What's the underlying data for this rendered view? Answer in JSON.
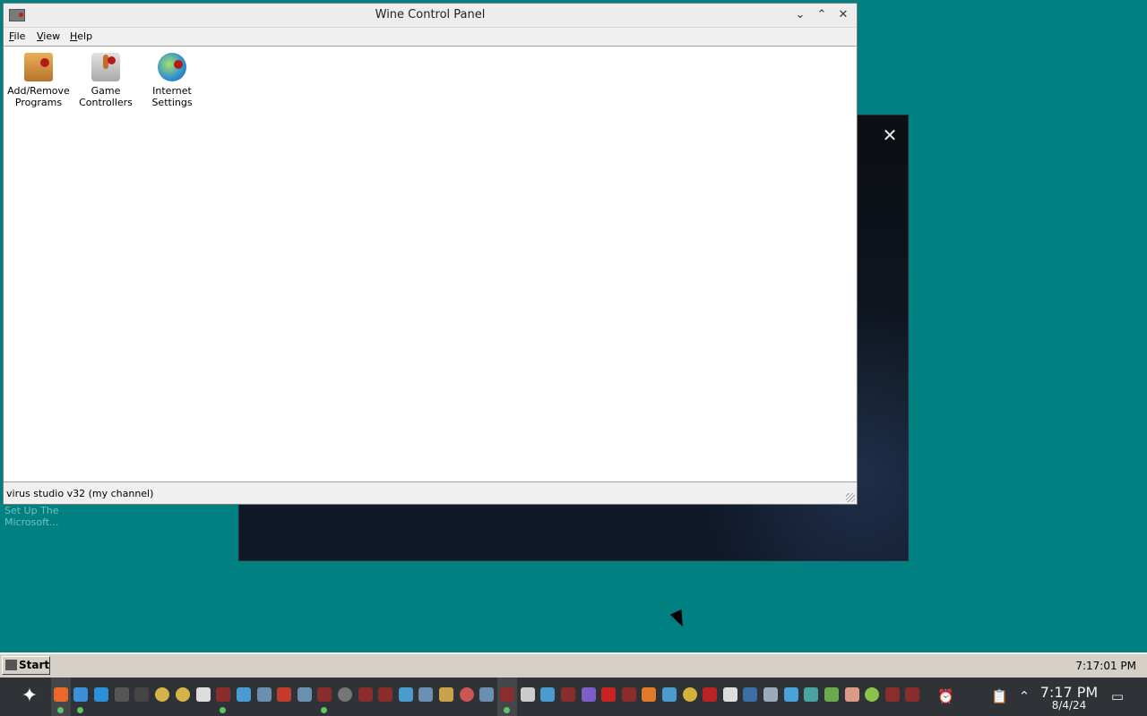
{
  "background_window": {
    "close_label": "✕"
  },
  "desktop": {
    "icon_text_line1": "Set Up The",
    "icon_text_line2": "Microsoft..."
  },
  "wine_window": {
    "title": "Wine Control Panel",
    "buttons": {
      "minimize": "⌄",
      "maximize": "⌃",
      "close": "✕"
    },
    "menu": [
      {
        "accel": "F",
        "rest": "ile"
      },
      {
        "accel": "V",
        "rest": "iew"
      },
      {
        "accel": "H",
        "rest": "elp"
      }
    ],
    "items": [
      {
        "line1": "Add/Remove",
        "line2": "Programs",
        "icon": "add-remove-programs-icon"
      },
      {
        "line1": "Game",
        "line2": "Controllers",
        "icon": "game-controllers-icon"
      },
      {
        "line1": "Internet",
        "line2": "Settings",
        "icon": "internet-settings-icon"
      }
    ],
    "status": "virus studio v32 (my channel)"
  },
  "wine_taskbar": {
    "start_label": "Start",
    "clock": "7:17:01 PM"
  },
  "panel": {
    "time": "7:17 PM",
    "date": "8/4/24",
    "accent": "#2f3236"
  }
}
